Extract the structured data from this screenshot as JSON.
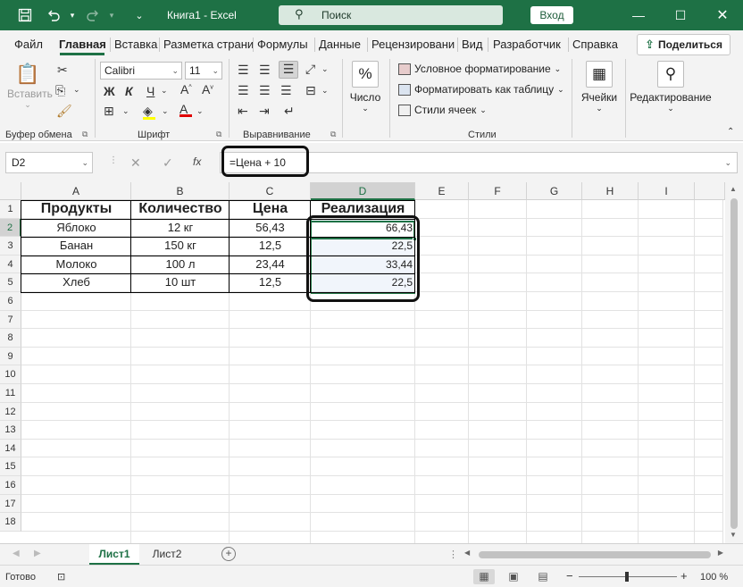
{
  "titlebar": {
    "title": "Книга1 - Excel",
    "search_placeholder": "Поиск",
    "login": "Вход",
    "save_icon": "save-icon",
    "undo_icon": "undo-icon",
    "redo_icon": "redo-icon"
  },
  "tabs": [
    "Файл",
    "Главная",
    "Вставка",
    "Разметка страни",
    "Формулы",
    "Данные",
    "Рецензировани",
    "Вид",
    "Разработчик",
    "Справка"
  ],
  "share": "Поделиться",
  "ribbon": {
    "clipboard": {
      "paste": "Вставить",
      "label": "Буфер обмена"
    },
    "font": {
      "name": "Calibri",
      "size": "11",
      "bold": "Ж",
      "italic": "К",
      "underline": "Ч",
      "label": "Шрифт"
    },
    "alignment": {
      "label": "Выравнивание"
    },
    "number": {
      "label": "Число",
      "icon_text": "%"
    },
    "styles": {
      "conditional": "Условное форматирование",
      "as_table": "Форматировать как таблицу",
      "cell_styles": "Стили ячеек",
      "label": "Стили"
    },
    "cells": {
      "label": "Ячейки"
    },
    "editing": {
      "label": "Редактирование"
    }
  },
  "formula_bar": {
    "name_box": "D2",
    "formula": "=Цена + 10",
    "fx": "fx"
  },
  "columns": [
    "A",
    "B",
    "C",
    "D",
    "E",
    "F",
    "G",
    "H",
    "I"
  ],
  "rows": [
    "1",
    "2",
    "3",
    "4",
    "5",
    "6",
    "7",
    "8",
    "9",
    "10",
    "11",
    "12",
    "13",
    "14",
    "15",
    "16",
    "17",
    "18"
  ],
  "table": {
    "headers": [
      "Продукты",
      "Количество",
      "Цена",
      "Реализация"
    ],
    "rows": [
      [
        "Яблоко",
        "12 кг",
        "56,43",
        "66,43"
      ],
      [
        "Банан",
        "150 кг",
        "12,5",
        "22,5"
      ],
      [
        "Молоко",
        "100 л",
        "23,44",
        "33,44"
      ],
      [
        "Хлеб",
        "10 шт",
        "12,5",
        "22,5"
      ]
    ]
  },
  "sheets": [
    "Лист1",
    "Лист2"
  ],
  "status": {
    "ready": "Готово",
    "zoom": "100 %",
    "minus": "−",
    "plus": "+"
  },
  "colors": {
    "accent": "#1e7145",
    "ribbon_bg": "#f3f3f3"
  }
}
